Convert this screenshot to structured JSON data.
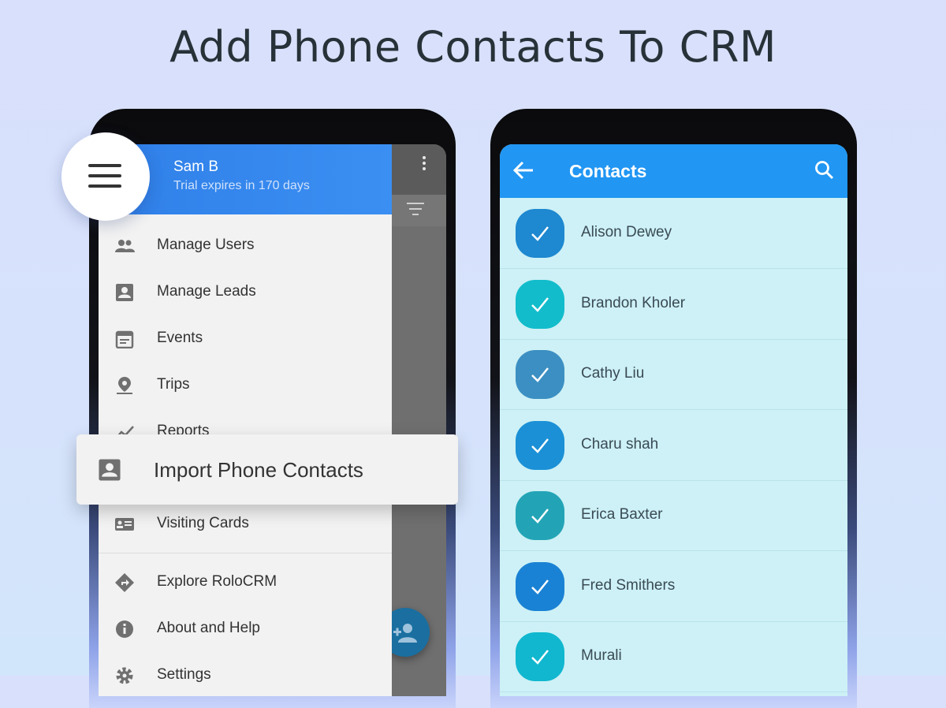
{
  "headline": "Add Phone Contacts To CRM",
  "drawer": {
    "user_name": "Sam B",
    "user_sub": "Trial expires in 170 days",
    "items": [
      {
        "label": "Manage Users",
        "icon": "people-icon"
      },
      {
        "label": "Manage Leads",
        "icon": "contact-card-icon"
      },
      {
        "label": "Events",
        "icon": "calendar-icon"
      },
      {
        "label": "Trips",
        "icon": "location-pin-icon"
      },
      {
        "label": "Reports",
        "icon": "trend-chart-icon"
      },
      {
        "label": "Visiting Cards",
        "icon": "business-card-icon"
      },
      {
        "label": "Explore RoloCRM",
        "icon": "directions-icon"
      },
      {
        "label": "About and Help",
        "icon": "info-icon"
      },
      {
        "label": "Settings",
        "icon": "gear-icon"
      }
    ]
  },
  "import_card": {
    "label": "Import Phone Contacts",
    "icon": "contact-card-icon"
  },
  "contacts": {
    "title": "Contacts",
    "items": [
      {
        "name": "Alison Dewey",
        "color": "#1e88d0"
      },
      {
        "name": "Brandon Kholer",
        "color": "#12bccb"
      },
      {
        "name": "Cathy Liu",
        "color": "#3c8fc2"
      },
      {
        "name": "Charu shah",
        "color": "#1b90d6"
      },
      {
        "name": "Erica Baxter",
        "color": "#23a4b6"
      },
      {
        "name": "Fred Smithers",
        "color": "#1a82d4"
      },
      {
        "name": "Murali",
        "color": "#10b7cf"
      }
    ]
  },
  "colors": {
    "accent": "#2196f3",
    "drawer_header": "#3b8ff2"
  }
}
